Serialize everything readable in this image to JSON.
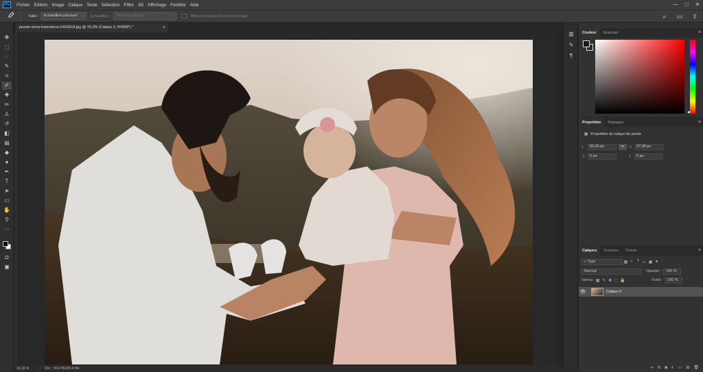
{
  "menubar": {
    "logo": "Ps",
    "items": [
      "Fichier",
      "Edition",
      "Image",
      "Calque",
      "Texte",
      "Sélection",
      "Filtre",
      "3D",
      "Affichage",
      "Fenêtre",
      "Aide"
    ],
    "window_controls": [
      "—",
      "□",
      "✕"
    ]
  },
  "options": {
    "tool_icon": "eyedropper-icon",
    "size_label": "Taille :",
    "size_value": "Echantillon ponctuel",
    "sample_label": "Echantillon :",
    "sample_value": "Tous les calques",
    "ring_label": "Afficher anneau d'échantillonnage",
    "right_icons": [
      "search-icon",
      "workspace-icon",
      "share-icon"
    ]
  },
  "tools": [
    "move-icon",
    "marquee-icon",
    "lasso-icon",
    "quick-select-icon",
    "crop-icon",
    "eyedropper-icon",
    "healing-brush-icon",
    "brush-icon",
    "clone-stamp-icon",
    "history-brush-icon",
    "eraser-icon",
    "gradient-icon",
    "blur-icon",
    "dodge-icon",
    "pen-icon",
    "type-icon",
    "path-select-icon",
    "rectangle-icon",
    "hand-icon",
    "zoom-icon",
    "more-tools-icon"
  ],
  "document": {
    "tab_title": "pexels-arina-krasnikova-5416618.jpg @ 33,3% (Calque 0, RVB/8*) *",
    "close": "×"
  },
  "status": {
    "zoom": "33,33 %",
    "doc_size": "Doc : 30,6 Mo/30,6 Mo",
    "arrow": "›"
  },
  "color_panel": {
    "tabs": [
      "Couleur",
      "Nuancier"
    ],
    "active_tab": 0
  },
  "properties_panel": {
    "tabs": [
      "Propriétés",
      "Réglages"
    ],
    "active_tab": 0,
    "subtitle": "Propriétés du calque de pixels",
    "w_label": "L",
    "w_value": "55,56 po",
    "h_label": "H",
    "h_value": "37,08 po",
    "x_label": "X",
    "x_value": "0 po",
    "y_label": "Y",
    "y_value": "0 po"
  },
  "layers_panel": {
    "tabs": [
      "Calques",
      "Couches",
      "Tracés"
    ],
    "active_tab": 0,
    "filter_value": "Type",
    "blend_mode": "Normal",
    "opacity_label": "Opacité :",
    "opacity_value": "100 %",
    "lock_label": "Verrou :",
    "fill_label": "Fond :",
    "fill_value": "100 %",
    "layers": [
      {
        "name": "Calque 0",
        "visible": true,
        "selected": true
      }
    ]
  }
}
